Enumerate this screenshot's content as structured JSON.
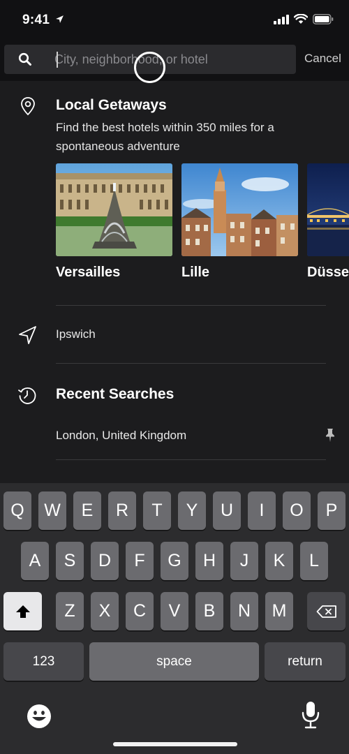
{
  "status_bar": {
    "time": "9:41"
  },
  "search": {
    "placeholder": "City, neighborhood, or hotel",
    "cancel_label": "Cancel"
  },
  "local_getaways": {
    "title": "Local Getaways",
    "description": "Find the best hotels within 350 miles for a spontaneous adventure",
    "destinations": [
      {
        "name": "Versailles"
      },
      {
        "name": "Lille"
      },
      {
        "name": "Düsseldorf"
      }
    ]
  },
  "nearby": {
    "label": "Ipswich"
  },
  "recent_searches": {
    "title": "Recent Searches",
    "items": [
      {
        "label": "London, United Kingdom"
      }
    ]
  },
  "keyboard": {
    "row1": [
      "Q",
      "W",
      "E",
      "R",
      "T",
      "Y",
      "U",
      "I",
      "O",
      "P"
    ],
    "row2": [
      "A",
      "S",
      "D",
      "F",
      "G",
      "H",
      "J",
      "K",
      "L"
    ],
    "row3": [
      "Z",
      "X",
      "C",
      "V",
      "B",
      "N",
      "M"
    ],
    "numbers_label": "123",
    "space_label": "space",
    "return_label": "return"
  },
  "icons": {
    "location": "location-pin-icon",
    "nearby": "navigation-arrow-icon",
    "recent": "history-clock-icon",
    "pin": "pushpin-icon",
    "search": "search-icon"
  }
}
